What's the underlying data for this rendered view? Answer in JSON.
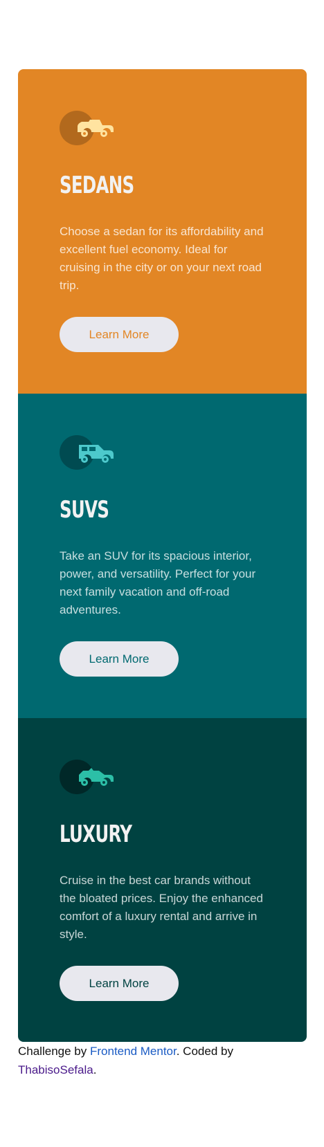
{
  "colors": {
    "sedans": "#e28625",
    "suvs": "#006970",
    "luxury": "#004241",
    "button_bg": "#e8e8ee",
    "link_fm": "#1a5bc4",
    "link_author": "#4a1a8a"
  },
  "cards": [
    {
      "icon": "sedan-car-icon",
      "title": "Sedans",
      "description": "Choose a sedan for its affordability and excellent fuel economy. Ideal for cruising in the city or on your next road trip.",
      "button_label": "Learn More"
    },
    {
      "icon": "suv-car-icon",
      "title": "SUVs",
      "description": "Take an SUV for its spacious interior, power, and versatility. Perfect for your next family vacation and off-road adventures.",
      "button_label": "Learn More"
    },
    {
      "icon": "luxury-car-icon",
      "title": "Luxury",
      "description": "Cruise in the best car brands without the bloated prices. Enjoy the enhanced comfort of a luxury rental and arrive in style.",
      "button_label": "Learn More"
    }
  ],
  "attribution": {
    "prefix": "Challenge by",
    "challenge_link": "Frontend Mentor",
    "middle": ". Coded by",
    "author_link": "ThabisoSefala",
    "suffix": "."
  }
}
